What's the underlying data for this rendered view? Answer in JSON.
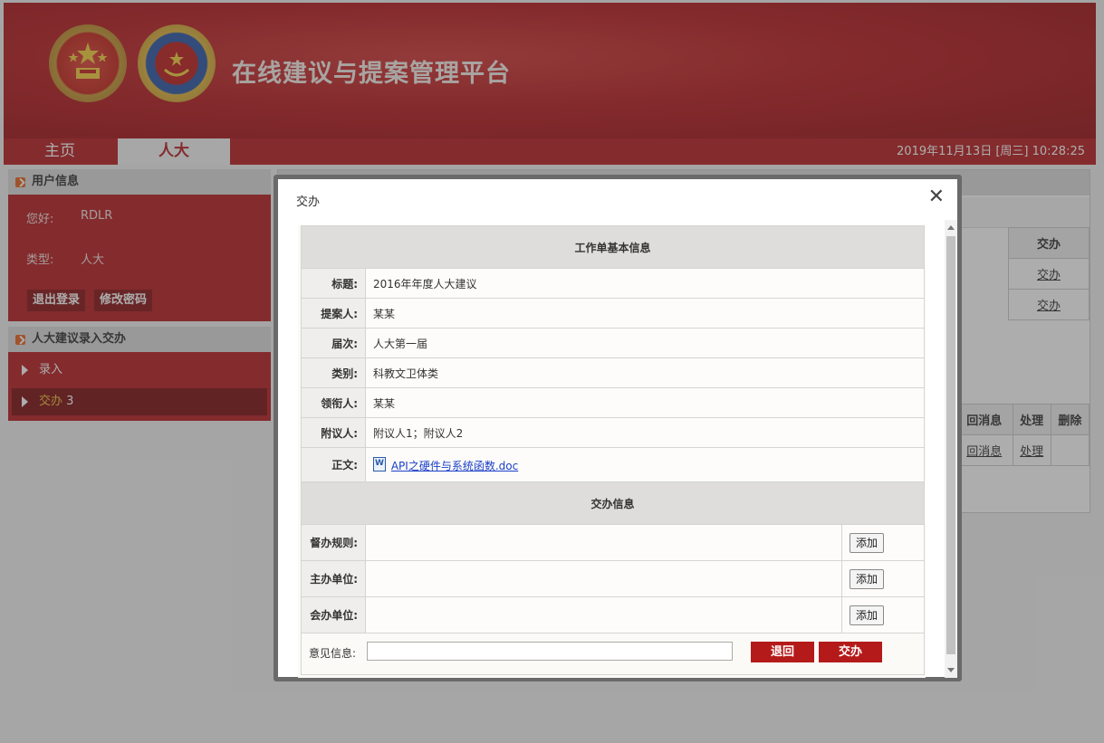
{
  "header": {
    "title": "在线建议与提案管理平台"
  },
  "nav": {
    "tabs": [
      {
        "label": "主页"
      },
      {
        "label": "人大"
      }
    ],
    "datetime": "2019年11月13日 [周三] 10:28:25"
  },
  "sidebar": {
    "user_panel": {
      "title": "用户信息",
      "greeting_label": "您好:",
      "username": "RDLR",
      "type_label": "类型:",
      "type_value": "人大",
      "logout_label": "退出登录",
      "change_password_label": "修改密码"
    },
    "menu_panel": {
      "title": "人大建议录入交办",
      "items": [
        {
          "label": "录入"
        },
        {
          "label": "交办",
          "count": "3"
        }
      ]
    }
  },
  "content": {
    "top_table": {
      "header": "交办",
      "rows": [
        "交办",
        "交办"
      ]
    },
    "bottom_table": {
      "headers": [
        "回消息",
        "处理",
        "删除"
      ],
      "row": [
        "回消息",
        "处理",
        ""
      ]
    }
  },
  "modal": {
    "title": "交办",
    "section_basic": "工作单基本信息",
    "fields": [
      {
        "label": "标题:",
        "value": "2016年年度人大建议"
      },
      {
        "label": "提案人:",
        "value": "某某"
      },
      {
        "label": "届次:",
        "value": "人大第一届"
      },
      {
        "label": "类别:",
        "value": "科教文卫体类"
      },
      {
        "label": "领衔人:",
        "value": "某某"
      },
      {
        "label": "附议人:",
        "value": "附议人1；附议人2"
      }
    ],
    "body_label": "正文:",
    "attachment": "API之硬件与系统函数.doc",
    "section_assign": "交办信息",
    "assign_rows": [
      {
        "label": "督办规则:",
        "button": "添加"
      },
      {
        "label": "主办单位:",
        "button": "添加"
      },
      {
        "label": "会办单位:",
        "button": "添加"
      }
    ],
    "opinion_label": "意见信息:",
    "opinion_value": "",
    "return_label": "退回",
    "assign_label": "交办"
  }
}
